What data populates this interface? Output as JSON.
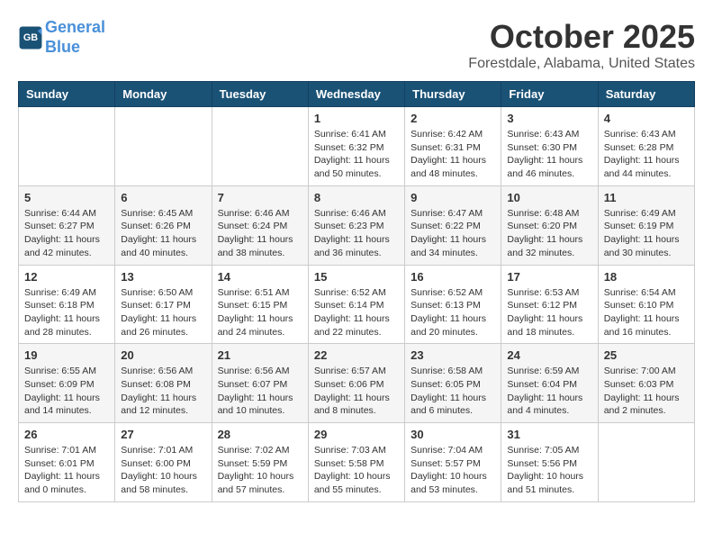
{
  "header": {
    "logo_line1": "General",
    "logo_line2": "Blue",
    "month": "October 2025",
    "location": "Forestdale, Alabama, United States"
  },
  "weekdays": [
    "Sunday",
    "Monday",
    "Tuesday",
    "Wednesday",
    "Thursday",
    "Friday",
    "Saturday"
  ],
  "weeks": [
    [
      {
        "day": "",
        "info": ""
      },
      {
        "day": "",
        "info": ""
      },
      {
        "day": "",
        "info": ""
      },
      {
        "day": "1",
        "info": "Sunrise: 6:41 AM\nSunset: 6:32 PM\nDaylight: 11 hours\nand 50 minutes."
      },
      {
        "day": "2",
        "info": "Sunrise: 6:42 AM\nSunset: 6:31 PM\nDaylight: 11 hours\nand 48 minutes."
      },
      {
        "day": "3",
        "info": "Sunrise: 6:43 AM\nSunset: 6:30 PM\nDaylight: 11 hours\nand 46 minutes."
      },
      {
        "day": "4",
        "info": "Sunrise: 6:43 AM\nSunset: 6:28 PM\nDaylight: 11 hours\nand 44 minutes."
      }
    ],
    [
      {
        "day": "5",
        "info": "Sunrise: 6:44 AM\nSunset: 6:27 PM\nDaylight: 11 hours\nand 42 minutes."
      },
      {
        "day": "6",
        "info": "Sunrise: 6:45 AM\nSunset: 6:26 PM\nDaylight: 11 hours\nand 40 minutes."
      },
      {
        "day": "7",
        "info": "Sunrise: 6:46 AM\nSunset: 6:24 PM\nDaylight: 11 hours\nand 38 minutes."
      },
      {
        "day": "8",
        "info": "Sunrise: 6:46 AM\nSunset: 6:23 PM\nDaylight: 11 hours\nand 36 minutes."
      },
      {
        "day": "9",
        "info": "Sunrise: 6:47 AM\nSunset: 6:22 PM\nDaylight: 11 hours\nand 34 minutes."
      },
      {
        "day": "10",
        "info": "Sunrise: 6:48 AM\nSunset: 6:20 PM\nDaylight: 11 hours\nand 32 minutes."
      },
      {
        "day": "11",
        "info": "Sunrise: 6:49 AM\nSunset: 6:19 PM\nDaylight: 11 hours\nand 30 minutes."
      }
    ],
    [
      {
        "day": "12",
        "info": "Sunrise: 6:49 AM\nSunset: 6:18 PM\nDaylight: 11 hours\nand 28 minutes."
      },
      {
        "day": "13",
        "info": "Sunrise: 6:50 AM\nSunset: 6:17 PM\nDaylight: 11 hours\nand 26 minutes."
      },
      {
        "day": "14",
        "info": "Sunrise: 6:51 AM\nSunset: 6:15 PM\nDaylight: 11 hours\nand 24 minutes."
      },
      {
        "day": "15",
        "info": "Sunrise: 6:52 AM\nSunset: 6:14 PM\nDaylight: 11 hours\nand 22 minutes."
      },
      {
        "day": "16",
        "info": "Sunrise: 6:52 AM\nSunset: 6:13 PM\nDaylight: 11 hours\nand 20 minutes."
      },
      {
        "day": "17",
        "info": "Sunrise: 6:53 AM\nSunset: 6:12 PM\nDaylight: 11 hours\nand 18 minutes."
      },
      {
        "day": "18",
        "info": "Sunrise: 6:54 AM\nSunset: 6:10 PM\nDaylight: 11 hours\nand 16 minutes."
      }
    ],
    [
      {
        "day": "19",
        "info": "Sunrise: 6:55 AM\nSunset: 6:09 PM\nDaylight: 11 hours\nand 14 minutes."
      },
      {
        "day": "20",
        "info": "Sunrise: 6:56 AM\nSunset: 6:08 PM\nDaylight: 11 hours\nand 12 minutes."
      },
      {
        "day": "21",
        "info": "Sunrise: 6:56 AM\nSunset: 6:07 PM\nDaylight: 11 hours\nand 10 minutes."
      },
      {
        "day": "22",
        "info": "Sunrise: 6:57 AM\nSunset: 6:06 PM\nDaylight: 11 hours\nand 8 minutes."
      },
      {
        "day": "23",
        "info": "Sunrise: 6:58 AM\nSunset: 6:05 PM\nDaylight: 11 hours\nand 6 minutes."
      },
      {
        "day": "24",
        "info": "Sunrise: 6:59 AM\nSunset: 6:04 PM\nDaylight: 11 hours\nand 4 minutes."
      },
      {
        "day": "25",
        "info": "Sunrise: 7:00 AM\nSunset: 6:03 PM\nDaylight: 11 hours\nand 2 minutes."
      }
    ],
    [
      {
        "day": "26",
        "info": "Sunrise: 7:01 AM\nSunset: 6:01 PM\nDaylight: 11 hours\nand 0 minutes."
      },
      {
        "day": "27",
        "info": "Sunrise: 7:01 AM\nSunset: 6:00 PM\nDaylight: 10 hours\nand 58 minutes."
      },
      {
        "day": "28",
        "info": "Sunrise: 7:02 AM\nSunset: 5:59 PM\nDaylight: 10 hours\nand 57 minutes."
      },
      {
        "day": "29",
        "info": "Sunrise: 7:03 AM\nSunset: 5:58 PM\nDaylight: 10 hours\nand 55 minutes."
      },
      {
        "day": "30",
        "info": "Sunrise: 7:04 AM\nSunset: 5:57 PM\nDaylight: 10 hours\nand 53 minutes."
      },
      {
        "day": "31",
        "info": "Sunrise: 7:05 AM\nSunset: 5:56 PM\nDaylight: 10 hours\nand 51 minutes."
      },
      {
        "day": "",
        "info": ""
      }
    ]
  ]
}
